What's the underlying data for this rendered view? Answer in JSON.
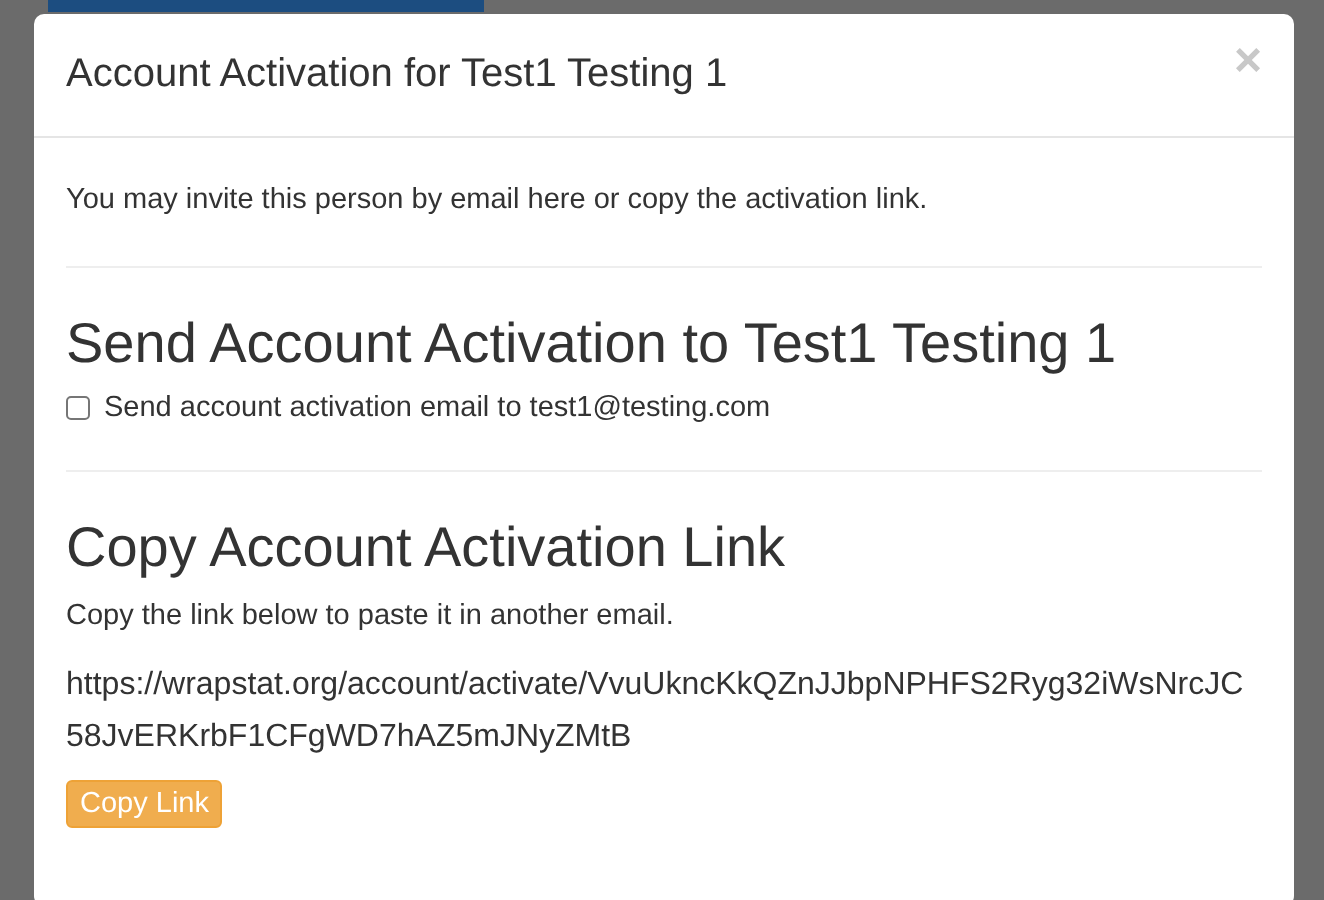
{
  "modal": {
    "title": "Account Activation for Test1 Testing 1",
    "close": "×",
    "intro": "You may invite this person by email here or copy the activation link.",
    "send_section": {
      "heading": "Send Account Activation to Test1 Testing 1",
      "checkbox_label": "Send account activation email to test1@testing.com",
      "checked": false
    },
    "copy_section": {
      "heading": "Copy Account Activation Link",
      "description": "Copy the link below to paste it in another email.",
      "link": "https://wrapstat.org/account/activate/VvuUkncKkQZnJJbpNPHFS2Ryg32iWsNrcJC58JvERKrbF1CFgWD7hAZ5mJNyZMtB",
      "button": "Copy Link"
    }
  }
}
